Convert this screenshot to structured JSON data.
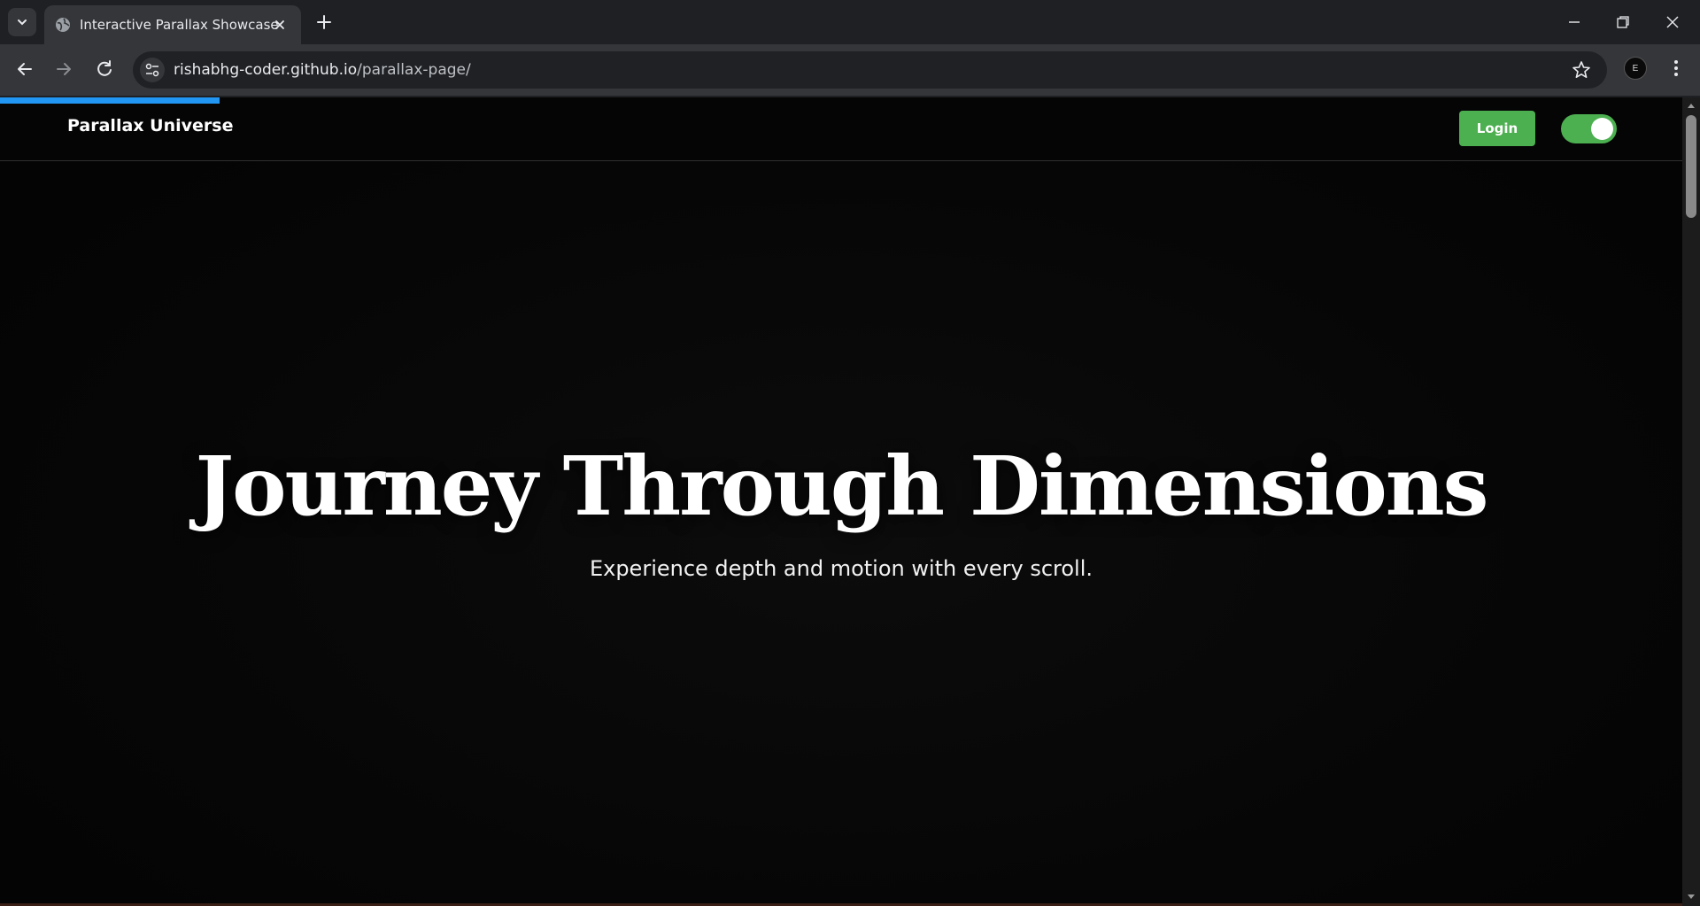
{
  "browser": {
    "tab": {
      "title": "Interactive Parallax Showcase",
      "favicon": "globe-icon"
    },
    "url": {
      "host": "rishabhg-coder.github.io",
      "path": "/parallax-page/"
    },
    "profile_initial": "E"
  },
  "page": {
    "scroll_progress_percent": 12.9,
    "header": {
      "brand": "Parallax Universe",
      "login_label": "Login",
      "theme_toggle_on": true
    },
    "hero": {
      "title": "Journey Through Dimensions",
      "subtitle": "Experience depth and motion with every scroll."
    }
  },
  "colors": {
    "accent_green": "#4caf50",
    "progress_blue": "#2196f3",
    "background": "#050505"
  }
}
